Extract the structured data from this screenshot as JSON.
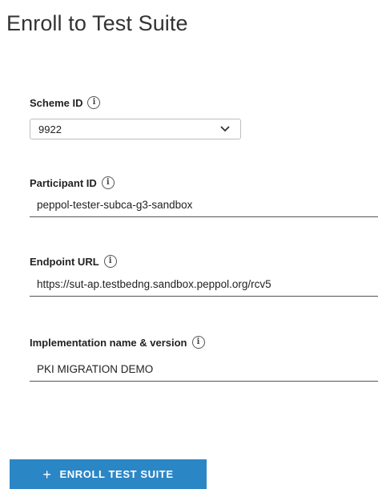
{
  "page": {
    "title": "Enroll to Test Suite"
  },
  "form": {
    "scheme_id": {
      "label": "Scheme ID",
      "info_icon": "i",
      "value": "9922"
    },
    "participant_id": {
      "label": "Participant ID",
      "info_icon": "i",
      "value": "peppol-tester-subca-g3-sandbox"
    },
    "endpoint_url": {
      "label": "Endpoint URL",
      "info_icon": "i",
      "value": "https://sut-ap.testbedng.sandbox.peppol.org/rcv5"
    },
    "implementation": {
      "label": "Implementation name & version",
      "info_icon": "i",
      "value": "PKI MIGRATION DEMO"
    }
  },
  "actions": {
    "enroll_icon": "+",
    "enroll_label": "ENROLL TEST SUITE"
  },
  "colors": {
    "button_bg": "#2b86c5",
    "button_text": "#ffffff"
  }
}
